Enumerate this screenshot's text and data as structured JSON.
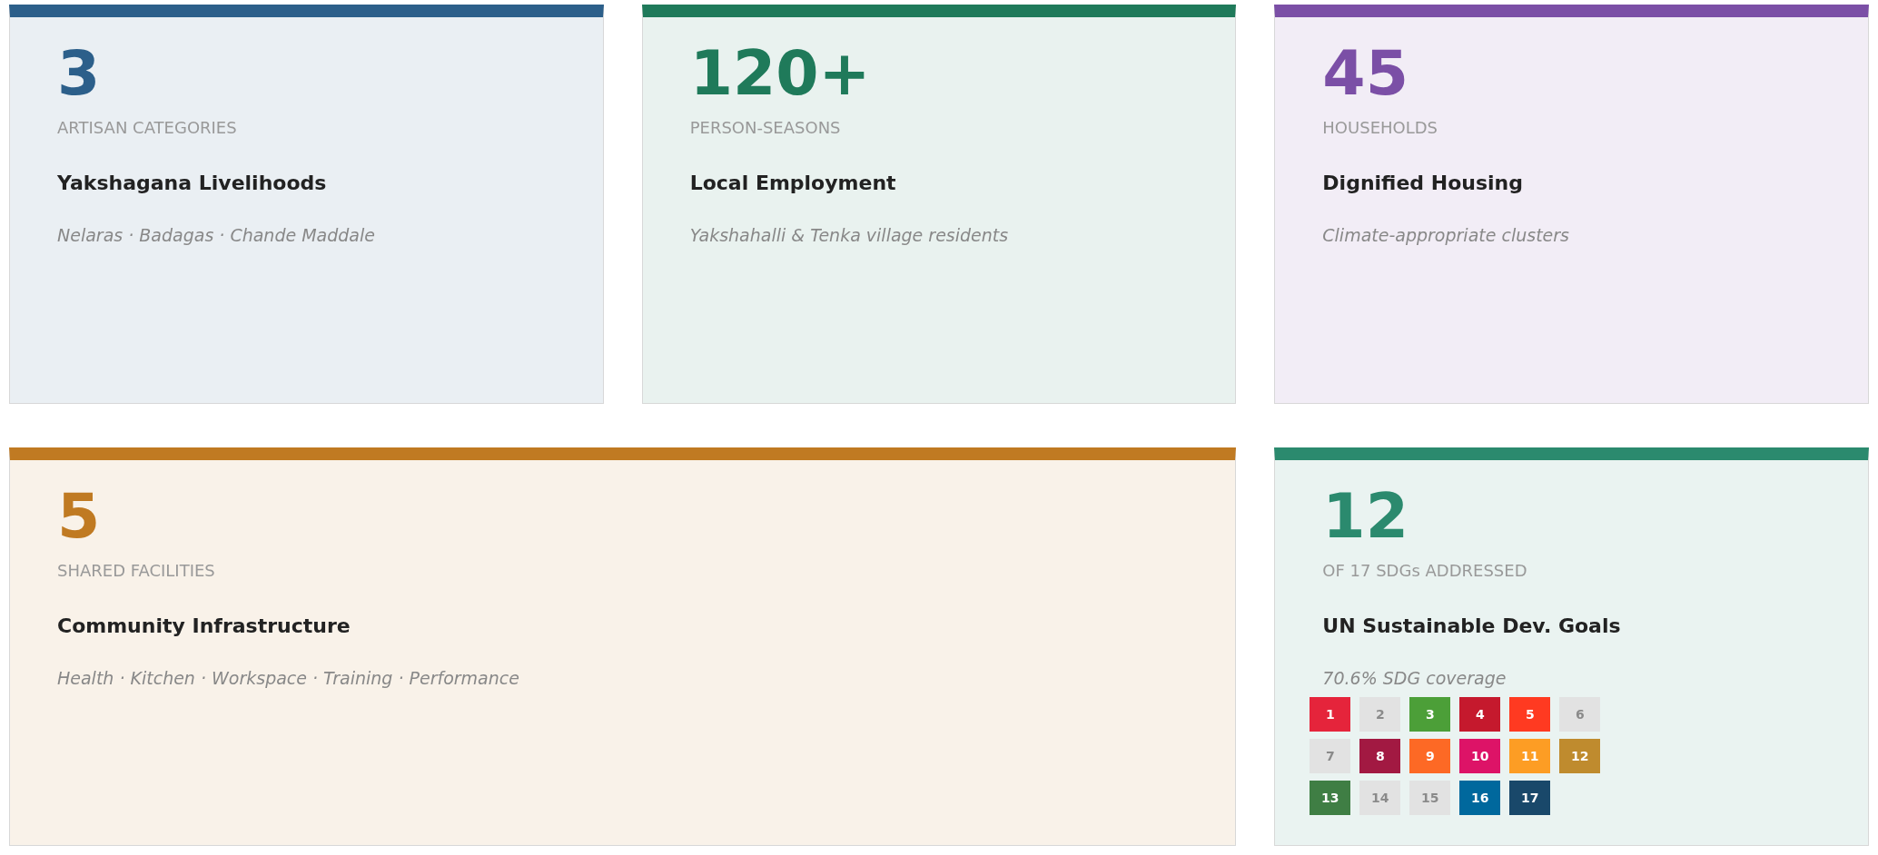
{
  "cards": [
    {
      "kind": "standard",
      "color": "#2c5f8a",
      "figure": "3",
      "unit": "ARTISAN CATEGORIES",
      "title": "Yakshagana Livelihoods",
      "detail": "Nelaras · Badagas · Chande Maddale"
    },
    {
      "kind": "standard",
      "color": "#1f7a5a",
      "figure": "120+",
      "unit": "PERSON-SEASONS",
      "title": "Local Employment",
      "detail": "Yakshahalli & Tenka village residents"
    },
    {
      "kind": "standard",
      "color": "#7b4fa6",
      "figure": "45",
      "unit": "HOUSEHOLDS",
      "title": "Dignified Housing",
      "detail": "Climate-appropriate clusters"
    },
    {
      "kind": "wide",
      "color": "#c07a22",
      "figure": "5",
      "unit": "SHARED FACILITIES",
      "title": "Community Infrastructure",
      "detail": "Health · Kitchen · Workspace · Training · Performance"
    },
    {
      "kind": "sdg",
      "color": "#2b8a6e",
      "figure": "12",
      "unit": "OF 17 SDGs ADDRESSED",
      "title": "UN Sustainable Dev. Goals",
      "detail": "70.6% SDG coverage",
      "goals": [
        {
          "number": "1",
          "addressed": true,
          "color": "#e5243b"
        },
        {
          "number": "2",
          "addressed": false
        },
        {
          "number": "3",
          "addressed": true,
          "color": "#4c9f38"
        },
        {
          "number": "4",
          "addressed": true,
          "color": "#c5192d"
        },
        {
          "number": "5",
          "addressed": true,
          "color": "#ff3a21"
        },
        {
          "number": "6",
          "addressed": false
        },
        {
          "number": "7",
          "addressed": false
        },
        {
          "number": "8",
          "addressed": true,
          "color": "#a21942"
        },
        {
          "number": "9",
          "addressed": true,
          "color": "#fd6925"
        },
        {
          "number": "10",
          "addressed": true,
          "color": "#dd1367"
        },
        {
          "number": "11",
          "addressed": true,
          "color": "#fd9d24"
        },
        {
          "number": "12",
          "addressed": true,
          "color": "#bf8b2e"
        },
        {
          "number": "13",
          "addressed": true,
          "color": "#3f7e44"
        },
        {
          "number": "14",
          "addressed": false
        },
        {
          "number": "15",
          "addressed": false
        },
        {
          "number": "16",
          "addressed": true,
          "color": "#00689d"
        },
        {
          "number": "17",
          "addressed": true,
          "color": "#19486a"
        }
      ]
    }
  ]
}
